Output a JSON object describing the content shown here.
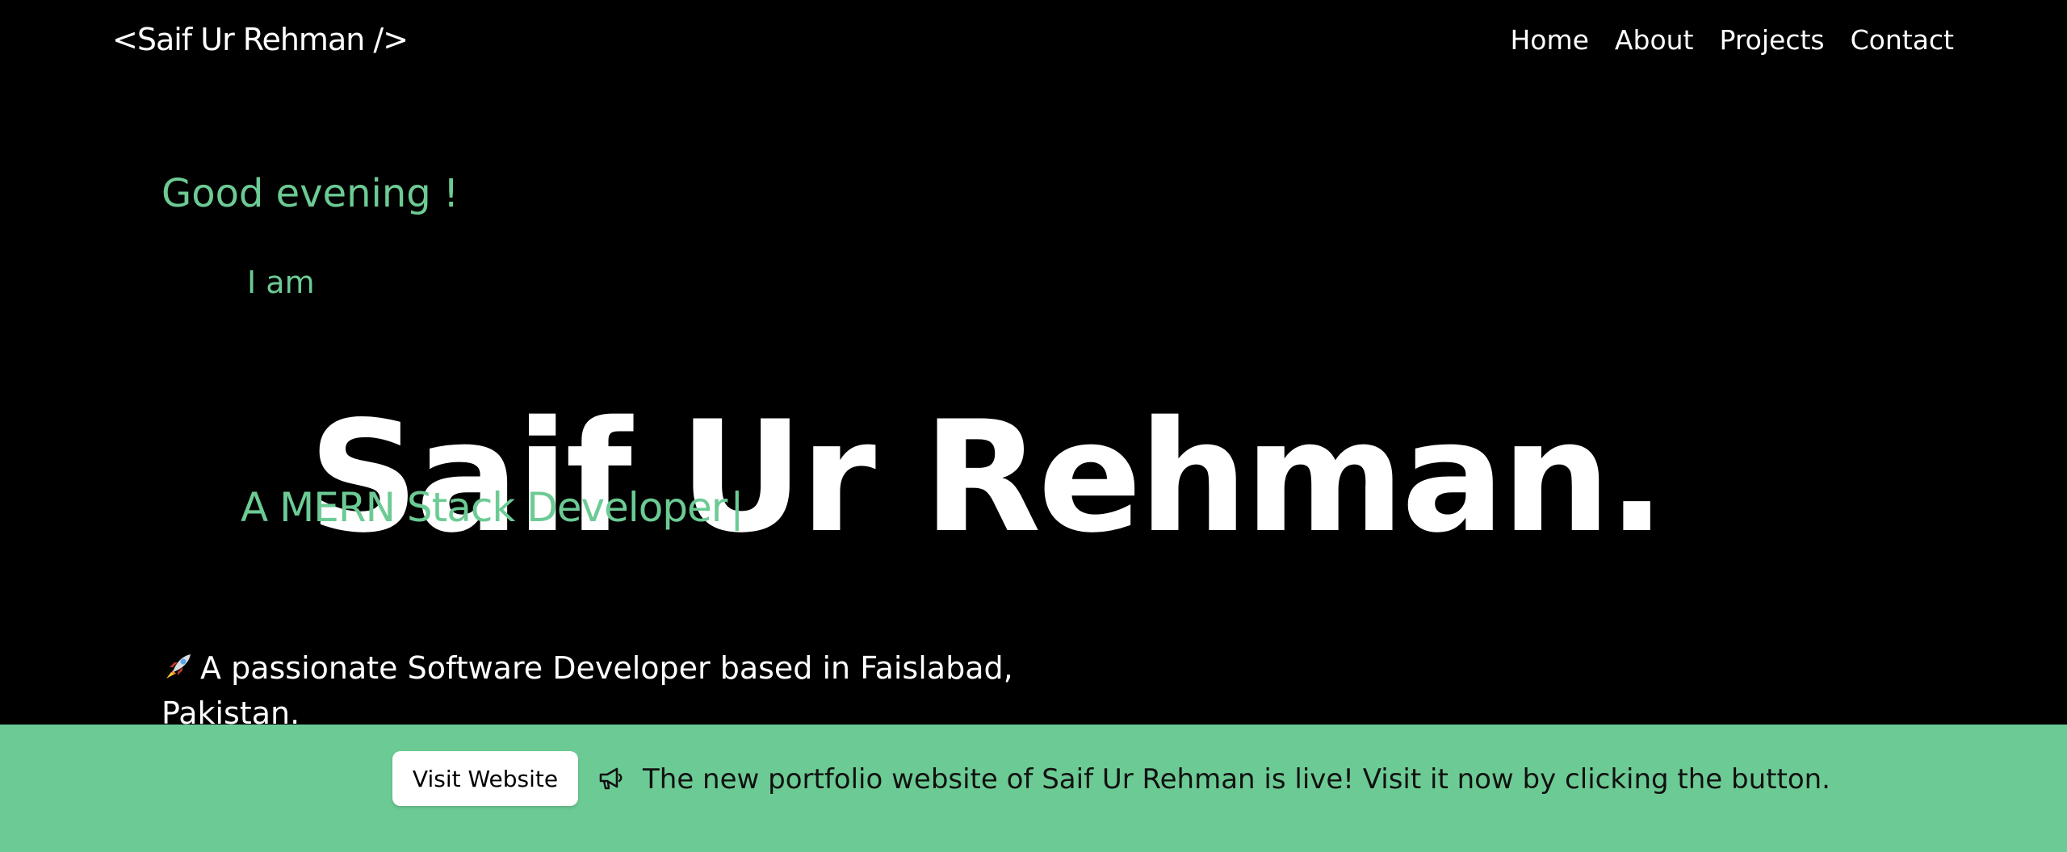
{
  "brand": {
    "label": "<Saif Ur Rehman />"
  },
  "nav": {
    "items": [
      {
        "label": "Home"
      },
      {
        "label": "About"
      },
      {
        "label": "Projects"
      },
      {
        "label": "Contact"
      }
    ]
  },
  "hero": {
    "greeting": "Good evening !",
    "intro_prefix": "I am",
    "name": "Saif Ur Rehman.",
    "role": "A MERN Stack Developer",
    "caret": "|",
    "description": "A passionate Software Developer based in Faislabad, Pakistan.",
    "description_icon": "rocket-icon"
  },
  "banner": {
    "button_label": "Visit Website",
    "icon": "megaphone-icon",
    "message_before": "The new portfolio website of",
    "message_name": "Saif Ur Rehman",
    "message_after": "is live! Visit it now by clicking the button."
  },
  "colors": {
    "background": "#000000",
    "accent": "#6ccb94",
    "text": "#ffffff",
    "banner_text": "#111111"
  }
}
